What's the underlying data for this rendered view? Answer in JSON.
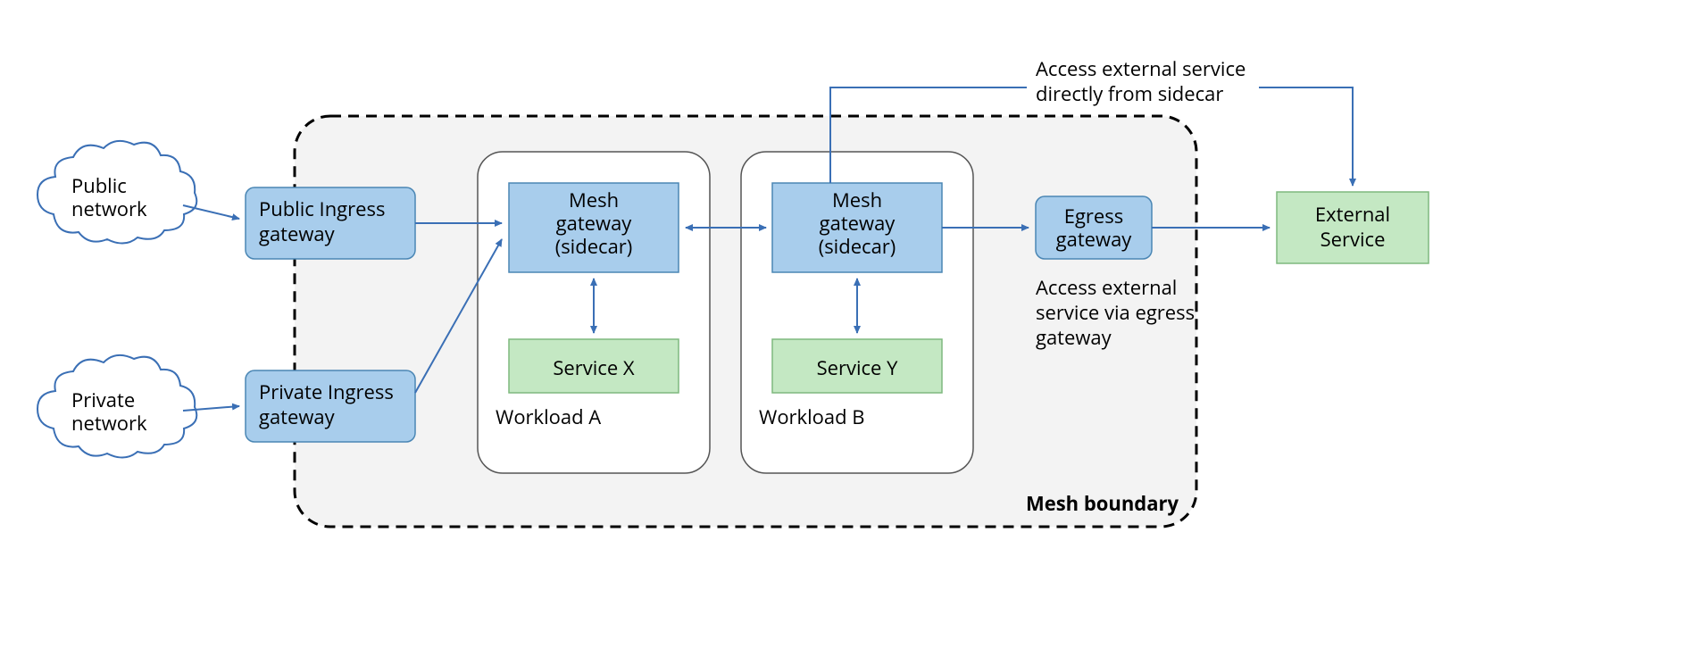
{
  "clouds": {
    "public": {
      "line1": "Public",
      "line2": "network"
    },
    "private": {
      "line1": "Private",
      "line2": "network"
    }
  },
  "ingress": {
    "public": {
      "line1": "Public Ingress",
      "line2": "gateway"
    },
    "private": {
      "line1": "Private Ingress",
      "line2": "gateway"
    }
  },
  "workloads": {
    "a": {
      "gateway": {
        "line1": "Mesh",
        "line2": "gateway",
        "line3": "(sidecar)"
      },
      "service": "Service X",
      "label": "Workload A"
    },
    "b": {
      "gateway": {
        "line1": "Mesh",
        "line2": "gateway",
        "line3": "(sidecar)"
      },
      "service": "Service Y",
      "label": "Workload B"
    }
  },
  "egress": {
    "line1": "Egress",
    "line2": "gateway"
  },
  "external": {
    "line1": "External",
    "line2": "Service"
  },
  "annotations": {
    "direct": {
      "line1": "Access external service",
      "line2": "directly from sidecar"
    },
    "via": {
      "line1": "Access external",
      "line2": "service via egress",
      "line3": "gateway"
    }
  },
  "meshLabel": "Mesh boundary"
}
